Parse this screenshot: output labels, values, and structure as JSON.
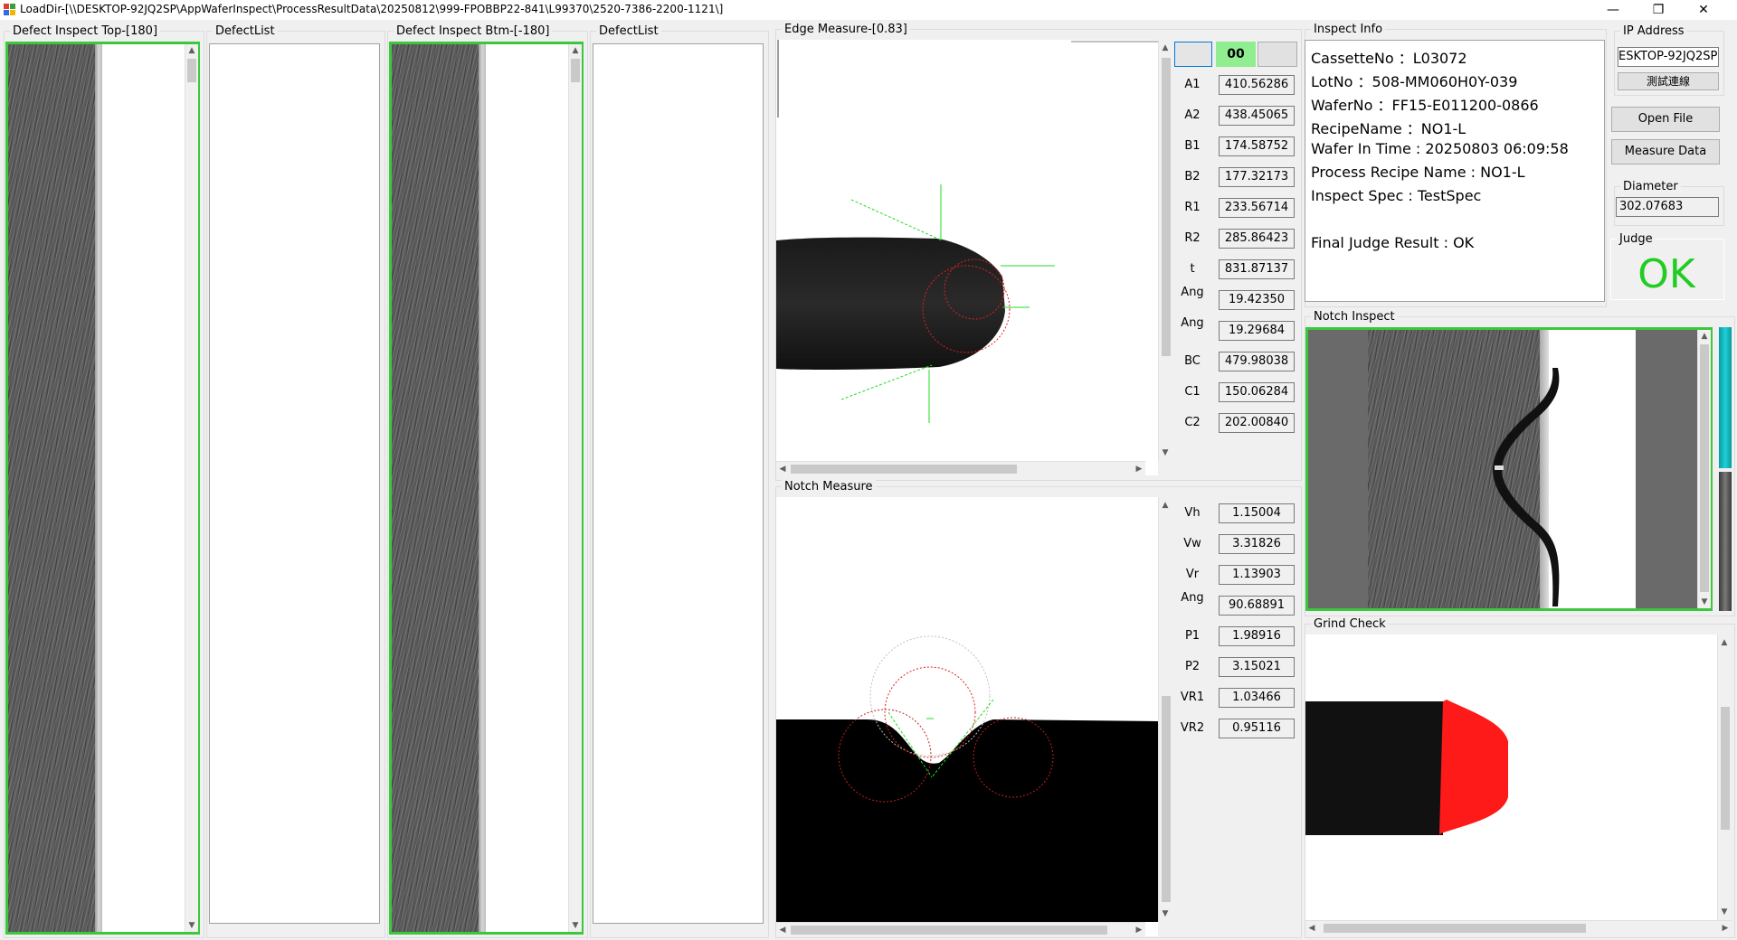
{
  "window": {
    "title": "LoadDir-[\\\\DESKTOP-92JQ2SP\\AppWaferInspect\\ProcessResultData\\20250812\\999-FPOBBP22-841\\L99370\\2520-7386-2200-1121\\]",
    "minimize": "—",
    "maximize": "❐",
    "close": "✕"
  },
  "panels": {
    "defect_top_label": "Defect Inspect Top-[180]",
    "defect_list_1_label": "DefectList",
    "defect_btm_label": "Defect Inspect Btm-[-180]",
    "defect_list_2_label": "DefectList",
    "edge_measure_label": "Edge Measure-[0.83]",
    "notch_measure_label": "Notch Measure",
    "inspect_info_label": "Inspect Info",
    "ip_address_label": "IP Address",
    "notch_inspect_label": "Notch Inspect",
    "grind_check_label": "Grind Check",
    "diameter_label": "Diameter",
    "judge_label": "Judge"
  },
  "edge_header": {
    "status_code": "00"
  },
  "edge_measures": [
    {
      "label": "A1",
      "value": "410.56286"
    },
    {
      "label": "A2",
      "value": "438.45065"
    },
    {
      "label": "B1",
      "value": "174.58752"
    },
    {
      "label": "B2",
      "value": "177.32173"
    },
    {
      "label": "R1",
      "value": "233.56714"
    },
    {
      "label": "R2",
      "value": "285.86423"
    },
    {
      "label": "t",
      "value": "831.87137"
    },
    {
      "label": "Ang",
      "value": "19.42350"
    },
    {
      "label": "Ang",
      "value": "19.29684"
    },
    {
      "label": "BC",
      "value": "479.98038"
    },
    {
      "label": "C1",
      "value": "150.06284"
    },
    {
      "label": "C2",
      "value": "202.00840"
    }
  ],
  "notch_measures": [
    {
      "label": "Vh",
      "value": "1.15004"
    },
    {
      "label": "Vw",
      "value": "3.31826"
    },
    {
      "label": "Vr",
      "value": "1.13903"
    },
    {
      "label": "Ang",
      "value": "90.68891"
    },
    {
      "label": "P1",
      "value": "1.98916"
    },
    {
      "label": "P2",
      "value": "3.15021"
    },
    {
      "label": "VR1",
      "value": "1.03466"
    },
    {
      "label": "VR2",
      "value": "0.95116"
    }
  ],
  "inspect_info": {
    "cassette": "CassetteNo ：L03072",
    "lot": "LotNo ：508-MM060H0Y-039",
    "wafer": "WaferNo ：FF15-E011200-0866",
    "recipe": "RecipeName ：NO1-L",
    "wafer_in_time": "Wafer In Time : 20250803 06:09:58",
    "process_recipe": "Process Recipe Name : NO1-L",
    "inspect_spec": "Inspect Spec : TestSpec",
    "final_judge": "Final Judge Result : OK"
  },
  "ip_address": {
    "value": "ESKTOP-92JQ2SP",
    "test_button": "測試連線"
  },
  "buttons": {
    "open_file": "Open File",
    "measure_data": "Measure Data"
  },
  "diameter": {
    "value": "302.07683"
  },
  "judge": {
    "value": "OK",
    "color": "#22cc22"
  },
  "colors": {
    "frame_green": "#3cc83c",
    "status_green": "#90ee90",
    "grind_red": "#ff1a1a",
    "teal_bar": "#00b3b3"
  }
}
